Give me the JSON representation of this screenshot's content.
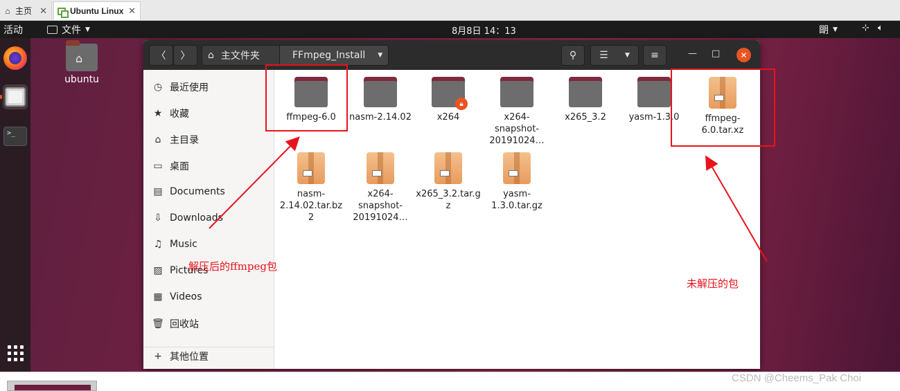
{
  "host_tabs": [
    {
      "label": "主页"
    },
    {
      "label": "Ubuntu Linux"
    }
  ],
  "topbar": {
    "activities": "活动",
    "app_menu": "文件",
    "clock": "8月8日  14：13",
    "ime": "朙"
  },
  "desktop": {
    "home_icon_label": "ubuntu"
  },
  "window": {
    "path_home": "主文件夹",
    "path_current": "FFmpeg_Install"
  },
  "sidebar": {
    "items": [
      {
        "label": "最近使用",
        "icon": "clock-icon"
      },
      {
        "label": "收藏",
        "icon": "star-icon"
      },
      {
        "label": "主目录",
        "icon": "home-icon"
      },
      {
        "label": "桌面",
        "icon": "desktop-icon"
      },
      {
        "label": "Documents",
        "icon": "document-icon"
      },
      {
        "label": "Downloads",
        "icon": "download-icon"
      },
      {
        "label": "Music",
        "icon": "music-icon"
      },
      {
        "label": "Pictures",
        "icon": "picture-icon"
      },
      {
        "label": "Videos",
        "icon": "video-icon"
      },
      {
        "label": "回收站",
        "icon": "trash-icon"
      },
      {
        "label": "其他位置",
        "icon": "plus-icon"
      }
    ]
  },
  "files": [
    {
      "name": "ffmpeg-6.0",
      "kind": "folder"
    },
    {
      "name": "nasm-2.14.02",
      "kind": "folder"
    },
    {
      "name": "x264",
      "kind": "folder-locked"
    },
    {
      "name": "x264-snapshot-20191024…",
      "kind": "folder"
    },
    {
      "name": "x265_3.2",
      "kind": "folder"
    },
    {
      "name": "yasm-1.3.0",
      "kind": "folder"
    },
    {
      "name": "ffmpeg-6.0.tar.xz",
      "kind": "archive"
    },
    {
      "name": "nasm-2.14.02.tar.bz2",
      "kind": "archive"
    },
    {
      "name": "x264-snapshot-20191024…",
      "kind": "archive"
    },
    {
      "name": "x265_3.2.tar.gz",
      "kind": "archive"
    },
    {
      "name": "yasm-1.3.0.tar.gz",
      "kind": "archive"
    }
  ],
  "annotations": {
    "extracted": "解压后的ffmpeg包",
    "not_extracted": "未解压的包",
    "color": "#e8131b"
  },
  "watermark": "CSDN @Cheems_Pak Choi",
  "colors": {
    "accent": "#e95420",
    "headerbar": "#2c2c2c",
    "topbar": "#1b1b1b"
  }
}
